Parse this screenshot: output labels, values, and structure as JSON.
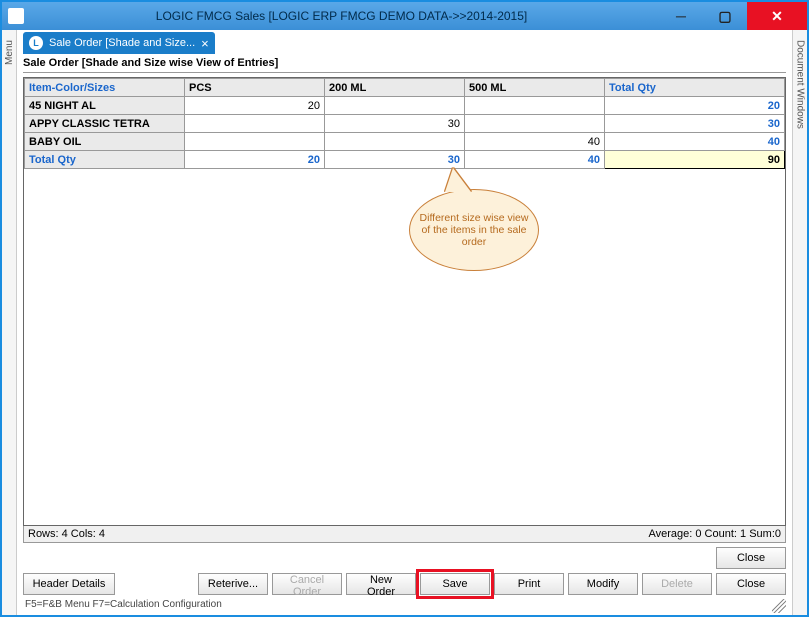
{
  "window": {
    "title": "LOGIC FMCG Sales  [LOGIC ERP FMCG DEMO DATA->>2014-2015]"
  },
  "side": {
    "left_label": "Menu",
    "right_label": "Document Windows"
  },
  "tab": {
    "label": "Sale Order [Shade and Size..."
  },
  "sub_header": "Sale Order [Shade and Size wise View of Entries]",
  "grid": {
    "headers": [
      "Item-Color/Sizes",
      "PCS",
      "200 ML",
      "500 ML",
      "Total Qty"
    ],
    "rows": [
      {
        "item": "45 NIGHT AL",
        "pcs": "20",
        "ml200": "",
        "ml500": "",
        "total": "20"
      },
      {
        "item": "APPY CLASSIC TETRA",
        "pcs": "",
        "ml200": "30",
        "ml500": "",
        "total": "30"
      },
      {
        "item": "BABY OIL",
        "pcs": "",
        "ml200": "",
        "ml500": "40",
        "total": "40"
      }
    ],
    "total_row": {
      "label": "Total Qty",
      "pcs": "20",
      "ml200": "30",
      "ml500": "40",
      "grand": "90"
    }
  },
  "callout_text": "Different size wise view of the items in the sale order",
  "grid_status": {
    "left": "Rows: 4  Cols: 4",
    "right": "Average: 0  Count: 1  Sum:0"
  },
  "buttons": {
    "close1": "Close",
    "header_details": "Header Details",
    "reterive": "Reterive...",
    "cancel_order": "Cancel Order",
    "new_order": "New Order",
    "save": "Save",
    "print": "Print",
    "modify": "Modify",
    "delete": "Delete",
    "close2": "Close"
  },
  "footer_hint": "F5=F&B Menu  F7=Calculation Configuration"
}
